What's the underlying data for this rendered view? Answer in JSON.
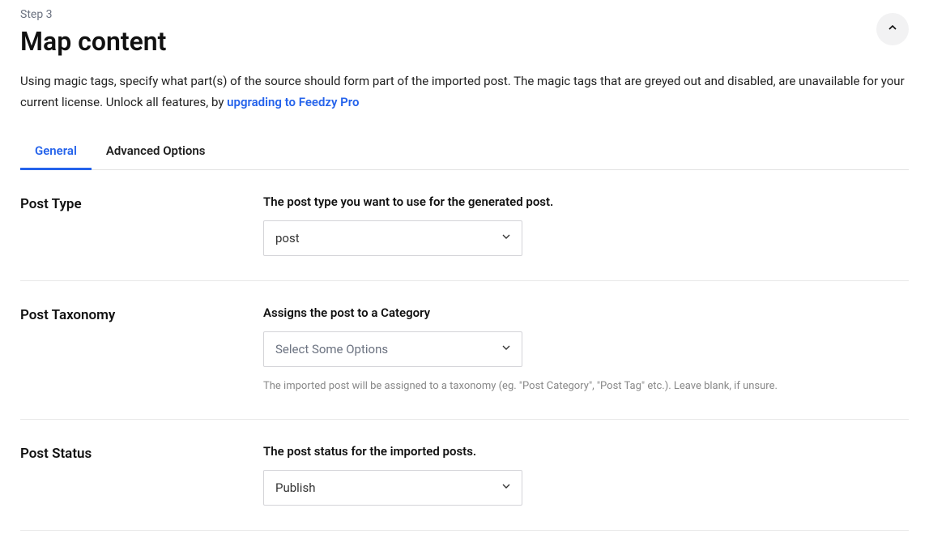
{
  "header": {
    "step": "Step 3",
    "title": "Map content",
    "description_prefix": "Using magic tags, specify what part(s) of the source should form part of the imported post. The magic tags that are greyed out and disabled, are unavailable for your current license. Unlock all features, by ",
    "upgrade_link": "upgrading to Feedzy Pro"
  },
  "tabs": {
    "general": "General",
    "advanced": "Advanced Options"
  },
  "fields": {
    "post_type": {
      "label": "Post Type",
      "desc": "The post type you want to use for the generated post.",
      "value": "post"
    },
    "post_taxonomy": {
      "label": "Post Taxonomy",
      "desc": "Assigns the post to a Category",
      "placeholder": "Select Some Options",
      "hint": "The imported post will be assigned to a taxonomy (eg. \"Post Category\", \"Post Tag\" etc.). Leave blank, if unsure."
    },
    "post_status": {
      "label": "Post Status",
      "desc": "The post status for the imported posts.",
      "value": "Publish"
    }
  }
}
